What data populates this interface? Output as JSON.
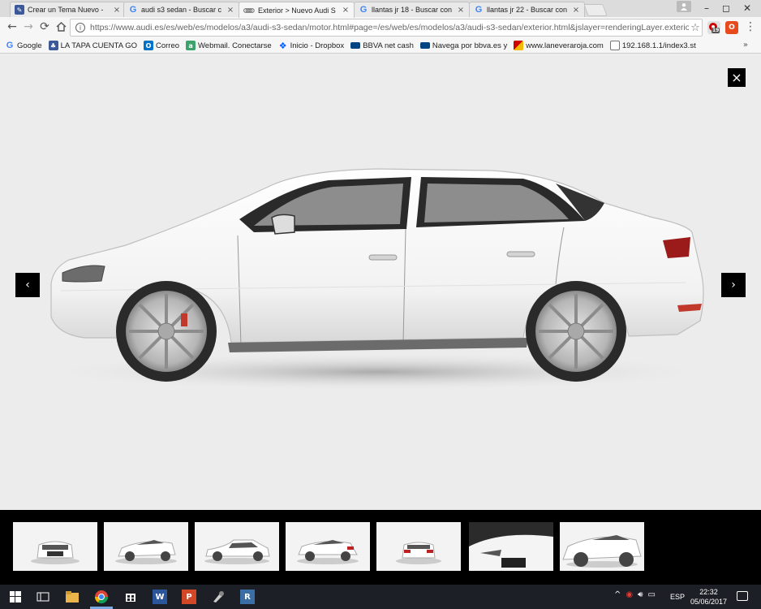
{
  "browser": {
    "tabs": [
      {
        "title": "Crear un Tema Nuevo - ",
        "icon": "cms-icon",
        "active": false
      },
      {
        "title": "audi s3 sedan - Buscar c",
        "icon": "google-icon",
        "active": false
      },
      {
        "title": "Exterior > Nuevo Audi S",
        "icon": "audi-icon",
        "active": true
      },
      {
        "title": "llantas jr 18 - Buscar con",
        "icon": "google-icon",
        "active": false
      },
      {
        "title": "llantas jr 22 - Buscar con",
        "icon": "google-icon",
        "active": false
      }
    ],
    "close_glyph": "×",
    "window_controls": {
      "minimize": "–",
      "maximize": "◻",
      "close": "✕"
    },
    "url": "https://www.audi.es/es/web/es/modelos/a3/audi-s3-sedan/motor.html#page=/es/web/es/modelos/a3/audi-s3-sedan/exterior.html&jslayer=renderingLayer.exterio",
    "extension_badge": "19",
    "bookmarks": [
      {
        "label": "Google",
        "icon": "google-icon",
        "color": "#ffffff"
      },
      {
        "label": "LA TAPA CUENTA GO",
        "icon": "bookmark-icon",
        "color": "#3b5998"
      },
      {
        "label": "Correo",
        "icon": "outlook-icon",
        "color": "#0072c6"
      },
      {
        "label": "Webmail. Conectarse",
        "icon": "webmail-icon",
        "color": "#3ca36c"
      },
      {
        "label": "Inicio - Dropbox",
        "icon": "dropbox-icon",
        "color": "#0061fe"
      },
      {
        "label": "BBVA net cash",
        "icon": "bbva-icon",
        "color": "#004481"
      },
      {
        "label": "Navega por bbva.es y",
        "icon": "bbva-icon",
        "color": "#004481"
      },
      {
        "label": "www.laneveraroja.com",
        "icon": "nevera-icon",
        "color": "#c00000"
      },
      {
        "label": "192.168.1.1/index3.st",
        "icon": "page-icon",
        "color": "#ffffff"
      }
    ],
    "bookmarks_more": "»"
  },
  "viewer": {
    "close_glyph": "×",
    "prev_glyph": "‹",
    "next_glyph": "›",
    "thumbnail_count": 7
  },
  "taskbar": {
    "time": "22:32",
    "date": "05/06/2017",
    "language": "ESP",
    "accent": "#7aa7e0"
  }
}
